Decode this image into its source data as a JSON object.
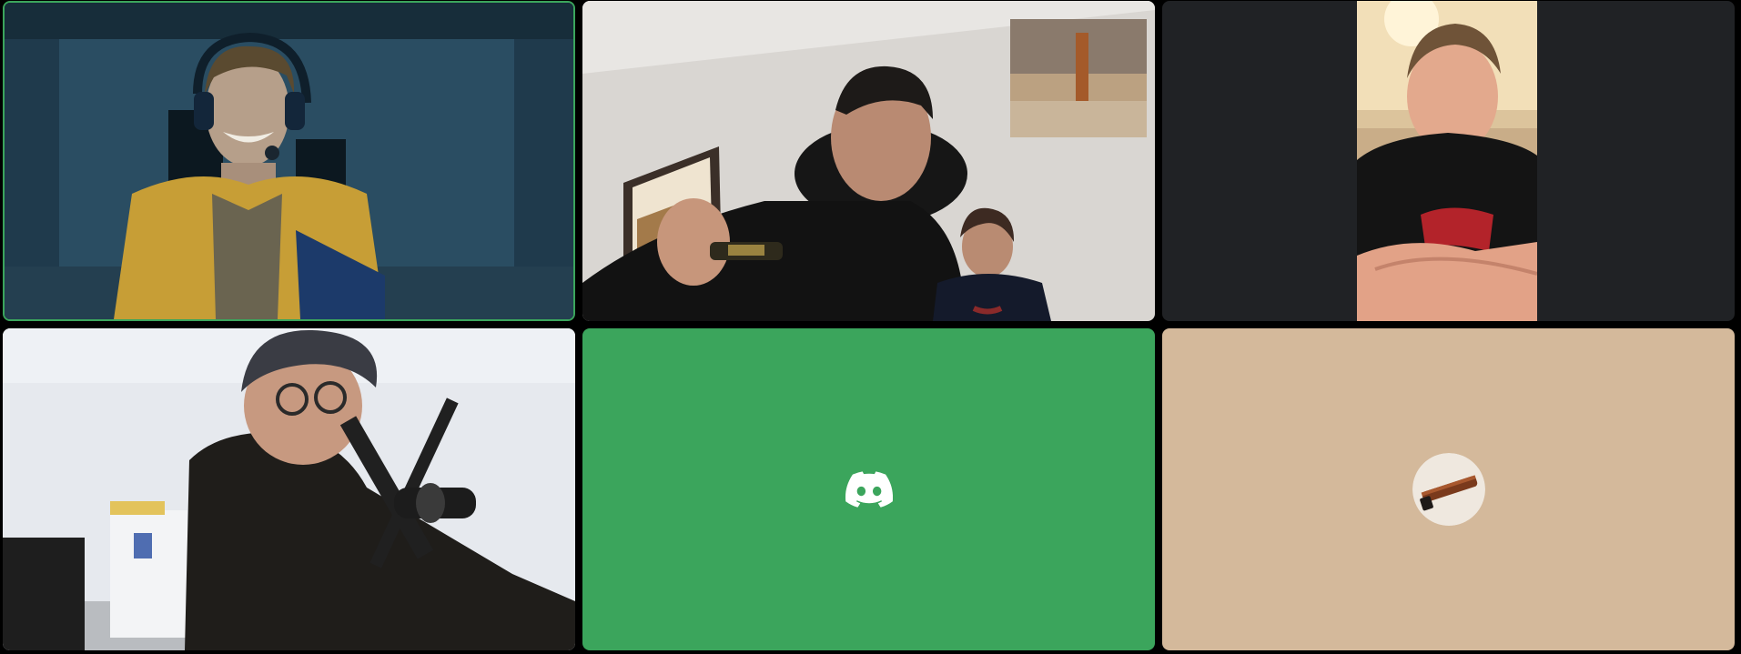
{
  "colors": {
    "speaking_border": "#3ba55c",
    "camera_off_green": "#3ba55c",
    "camera_off_tan": "#d4b99b",
    "tile_empty": "#202225",
    "background": "#000000"
  },
  "tiles": [
    {
      "kind": "video",
      "speaking": true,
      "icon": "webcam-feed"
    },
    {
      "kind": "video",
      "speaking": false,
      "icon": "webcam-feed"
    },
    {
      "kind": "video",
      "speaking": false,
      "icon": "webcam-feed-portrait"
    },
    {
      "kind": "video",
      "speaking": false,
      "icon": "webcam-feed"
    },
    {
      "kind": "avatar",
      "speaking": false,
      "icon": "discord-logo-icon"
    },
    {
      "kind": "avatar",
      "speaking": false,
      "icon": "user-avatar-image"
    }
  ]
}
